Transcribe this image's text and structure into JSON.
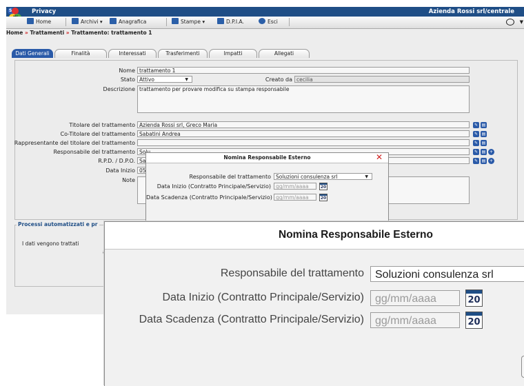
{
  "titlebar": {
    "app_title": "Privacy",
    "company": "Azienda Rossi srl/centrale",
    "logo_letters": [
      "S",
      "W"
    ]
  },
  "menu": {
    "home": "Home",
    "archivi": "Archivi ▾",
    "anagrafica": "Anagrafica",
    "stampe": "Stampe ▾",
    "dpia": "D.P.I.A.",
    "esci": "Esci"
  },
  "breadcrumb": {
    "home": "Home",
    "sep": "»",
    "trattamenti": "Trattamenti",
    "current": "Trattamento: trattamento 1"
  },
  "tabs": [
    "Dati Generali",
    "Finalità",
    "Interessati",
    "Trasferimenti",
    "Impatti",
    "Allegati"
  ],
  "form": {
    "nome_label": "Nome",
    "nome_value": "trattamento 1",
    "stato_label": "Stato",
    "stato_value": "Attivo",
    "creato_label": "Creato da",
    "creato_value": "cecilia",
    "descrizione_label": "Descrizione",
    "descrizione_value": "trattamento per provare modifica su stampa responsabile",
    "titolare_label": "Titolare del trattamento",
    "titolare_value": "Azienda Rossi srl, Greco Maria",
    "cotitolare_label": "Co-Titolare del trattamento",
    "cotitolare_value": "Sabatini Andrea",
    "rappresentante_label": "Rappresentante del titolare del trattamento",
    "rappresentante_value": "",
    "responsabile_label": "Responsabile del trattamento",
    "responsabile_value": "Solu",
    "rpd_label": "R.P.D. / D.P.O.",
    "rpd_value": "Sar",
    "datainizio_label": "Data Inizio",
    "datainizio_value": "05/",
    "note_label": "Note"
  },
  "lower_section": {
    "legend": "Processi automatizzati e pr",
    "text": "I dati vengono trattati",
    "a": "a",
    "dot1": ":",
    "dot2": ":"
  },
  "small_dialog": {
    "title": "Nomina Responsabile Esterno",
    "close": "✕",
    "resp_label": "Responsabile del trattamento",
    "resp_value": "Soluzioni consulenza srl",
    "inizio_label": "Data Inizio (Contratto Principale/Servizio)",
    "inizio_placeholder": "gg/mm/aaaa",
    "scad_label": "Data Scadenza (Contratto Principale/Servizio)",
    "scad_placeholder": "gg/mm/aaaa",
    "cal_text": "20"
  },
  "big_dialog": {
    "title": "Nomina Responsabile Esterno",
    "resp_label": "Responsabile del trattamento",
    "resp_value": "Soluzioni consulenza srl",
    "inizio_label": "Data Inizio (Contratto Principale/Servizio)",
    "inizio_placeholder": "gg/mm/aaaa",
    "scad_label": "Data Scadenza (Contratto Principale/Servizio)",
    "scad_placeholder": "gg/mm/aaaa",
    "cal_text": "20"
  },
  "colors": {
    "brand_blue": "#1f4e86",
    "accent_red": "#d02020",
    "tab_active": "#2a5aa8"
  }
}
